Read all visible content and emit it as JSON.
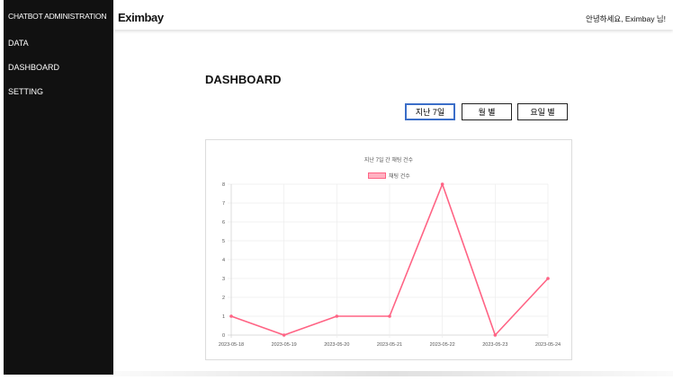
{
  "sidebar": {
    "brand": "CHATBOT ADMINISTRATION",
    "items": [
      {
        "label": "DATA"
      },
      {
        "label": "DASHBOARD"
      },
      {
        "label": "SETTING"
      }
    ]
  },
  "header": {
    "logo": "Eximbay",
    "greeting": "안녕하세요, Eximbay 님!"
  },
  "main": {
    "title": "DASHBOARD",
    "buttons": [
      {
        "label": "지난 7일",
        "active": true
      },
      {
        "label": "월 별",
        "active": false
      },
      {
        "label": "요일 별",
        "active": false
      }
    ]
  },
  "colors": {
    "line": "#ff6384",
    "legend_fill": "#ffb1c1",
    "active_border": "#3b6ec8",
    "sidebar_bg": "#111111"
  },
  "chart_data": {
    "type": "line",
    "title": "지난 7일 간 채팅 건수",
    "x": [
      "2023-05-18",
      "2023-05-19",
      "2023-05-20",
      "2023-05-21",
      "2023-05-22",
      "2023-05-23",
      "2023-05-24"
    ],
    "series": [
      {
        "name": "채팅 건수",
        "values": [
          1,
          0,
          1,
          1,
          8,
          0,
          3
        ]
      }
    ],
    "yticks": [
      0,
      1,
      2,
      3,
      4,
      5,
      6,
      7,
      8
    ],
    "ylim": [
      0,
      8
    ],
    "grid": true,
    "legend": "top-center"
  }
}
